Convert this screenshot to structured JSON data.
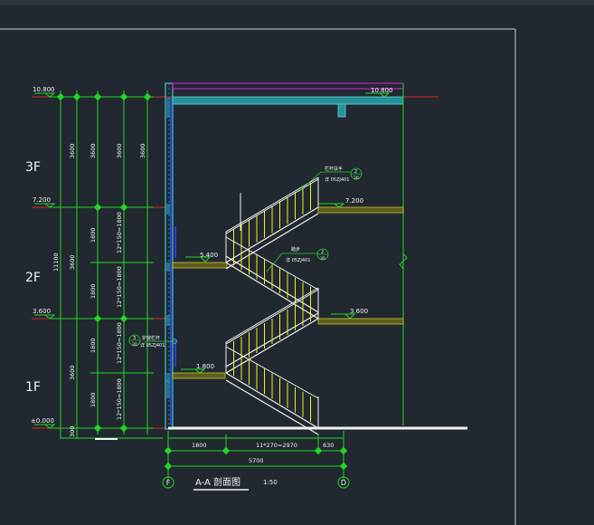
{
  "floors": {
    "f3": "3F",
    "f2": "2F",
    "f1": "1F"
  },
  "elevations": {
    "roof_left": "10.800",
    "roof_right": "10.800",
    "level3_left": "7.200",
    "level3_right": "7.200",
    "level2_left": "3.600",
    "level2_right": "3.600",
    "landing_upper": "5.400",
    "landing_lower": "1.800",
    "ground": "±0.000"
  },
  "dims_left": {
    "overall": "11100",
    "outer_3600_a": "3600",
    "outer_3600_b": "3600",
    "outer_3600_c": "3600",
    "outer_300": "300",
    "col2_top": "3600",
    "col2_mid_a": "1800",
    "col2_mid_b": "1800",
    "col2_low_a": "1800",
    "col2_low_b": "1800",
    "col3_top": "3600",
    "col3_a": "12*150=1800",
    "col3_b": "12*150=1800",
    "col3_c": "12*150=1800",
    "col3_d": "12*150=1800"
  },
  "dims_bottom": {
    "seg1": "1800",
    "seg2": "11*270=2970",
    "seg3": "630",
    "total": "5700"
  },
  "callouts": {
    "c1_text": "栏杆扶手",
    "c1_ref": "详 05ZJ401",
    "c1_num": "2",
    "c1_sheet": "30",
    "c2_text": "踏步",
    "c2_ref": "详 05ZJ401",
    "c2_num": "2",
    "c2_sheet": "30",
    "c3_text": "护窗栏杆",
    "c3_ref": "详 05ZJ401",
    "c3_num": "3",
    "c3_sheet": "30"
  },
  "title": {
    "name": "A-A  剖面图",
    "scale": "1:50"
  },
  "axes": {
    "left": "F",
    "right": "D"
  },
  "colors": {
    "background": "#212830",
    "dim_line": "#22d622",
    "railing": "#f2f21a",
    "section": "#45c6cf",
    "slab": "#c8c832",
    "level_line": "#d42a2a",
    "roof_outline": "#e01ee0",
    "white": "#f2f2f2"
  }
}
